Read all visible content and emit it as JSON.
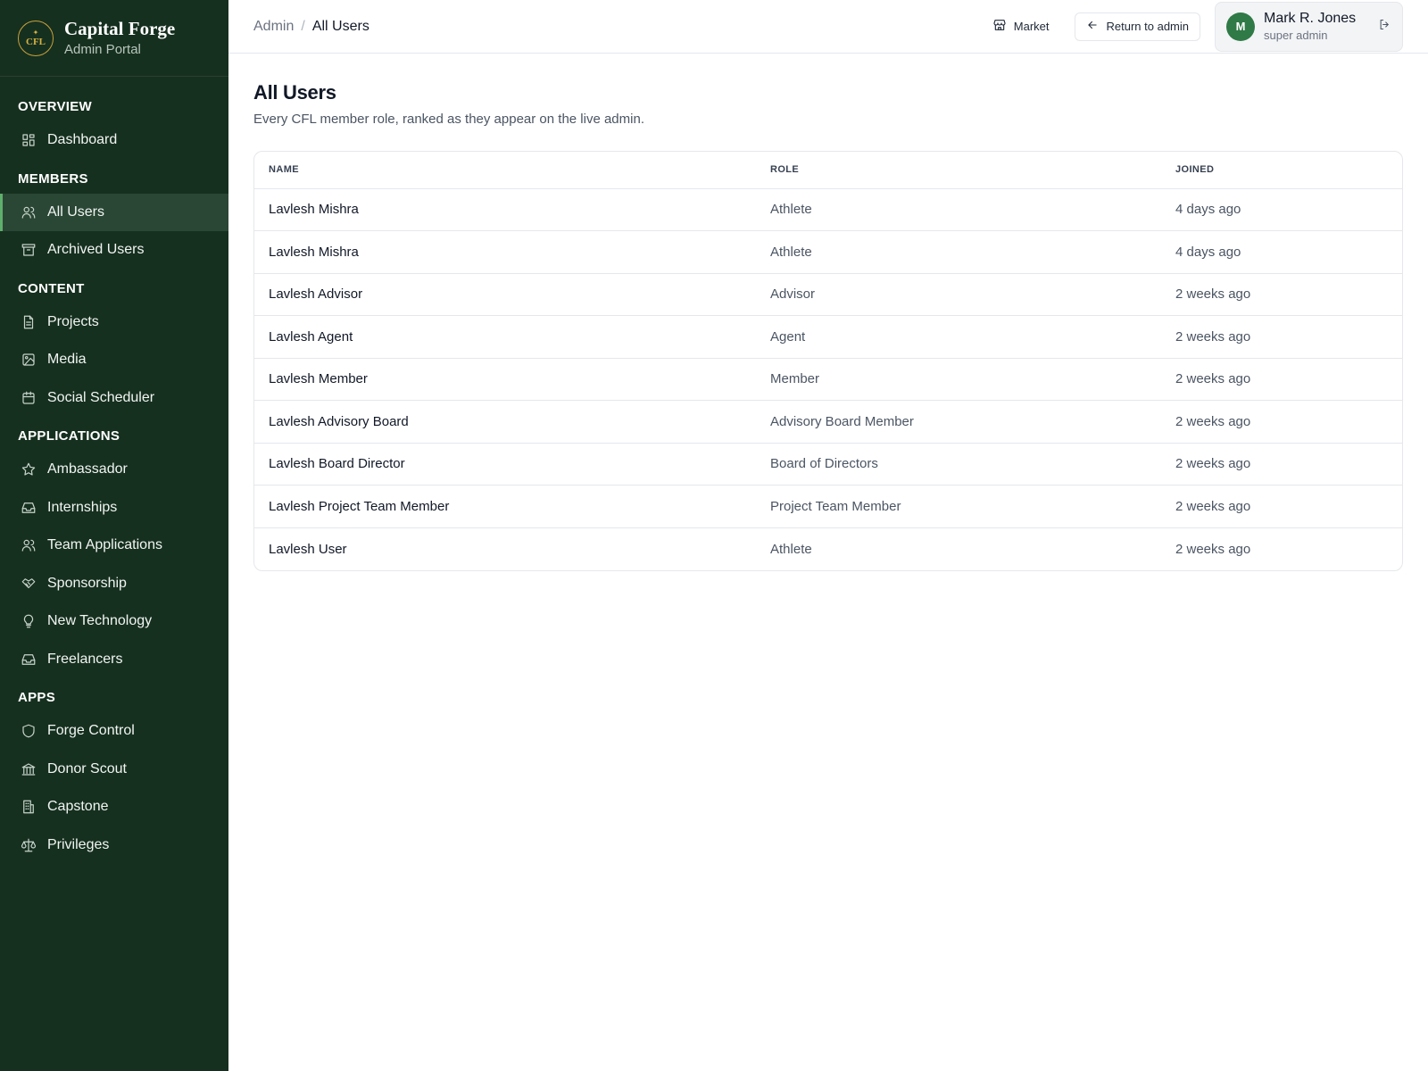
{
  "brand": {
    "name": "Capital Forge",
    "subtitle": "Admin Portal",
    "logo_text": "CFL",
    "colors": {
      "sidebar": "#16301f",
      "accent": "#5fae6c",
      "gold": "#c9a23a"
    }
  },
  "sidebar": {
    "sections": [
      {
        "title": "OVERVIEW",
        "items": [
          {
            "label": "Dashboard",
            "icon": "dashboard-icon"
          }
        ]
      },
      {
        "title": "MEMBERS",
        "items": [
          {
            "label": "All Users",
            "icon": "users-icon",
            "active": true
          },
          {
            "label": "Archived Users",
            "icon": "archive-icon"
          }
        ]
      },
      {
        "title": "CONTENT",
        "items": [
          {
            "label": "Projects",
            "icon": "file-icon"
          },
          {
            "label": "Media",
            "icon": "image-icon"
          },
          {
            "label": "Social Scheduler",
            "icon": "calendar-icon"
          }
        ]
      },
      {
        "title": "APPLICATIONS",
        "items": [
          {
            "label": "Ambassador",
            "icon": "star-icon"
          },
          {
            "label": "Internships",
            "icon": "inbox-icon"
          },
          {
            "label": "Team Applications",
            "icon": "users-icon"
          },
          {
            "label": "Sponsorship",
            "icon": "handshake-icon"
          },
          {
            "label": "New Technology",
            "icon": "lightbulb-icon"
          },
          {
            "label": "Freelancers",
            "icon": "inbox-icon"
          }
        ]
      },
      {
        "title": "APPS",
        "items": [
          {
            "label": "Forge Control",
            "icon": "shield-icon"
          },
          {
            "label": "Donor Scout",
            "icon": "bank-icon"
          },
          {
            "label": "Capstone",
            "icon": "building-icon"
          },
          {
            "label": "Privileges",
            "icon": "scale-icon"
          }
        ]
      }
    ]
  },
  "header": {
    "breadcrumb_root": "Admin",
    "breadcrumb_sep": "/",
    "breadcrumb_current": "All Users",
    "market_label": "Market",
    "return_label": "Return to admin",
    "user": {
      "initial": "M",
      "name": "Mark R. Jones",
      "role": "super admin"
    }
  },
  "main": {
    "title": "All Users",
    "description": "Every CFL member role, ranked as they appear on the live admin.",
    "columns": [
      "NAME",
      "ROLE",
      "JOINED"
    ],
    "rows": [
      {
        "name": "Lavlesh Mishra",
        "role": "Athlete",
        "joined": "4 days ago"
      },
      {
        "name": "Lavlesh Mishra",
        "role": "Athlete",
        "joined": "4 days ago"
      },
      {
        "name": "Lavlesh Advisor",
        "role": "Advisor",
        "joined": "2 weeks ago"
      },
      {
        "name": "Lavlesh Agent",
        "role": "Agent",
        "joined": "2 weeks ago"
      },
      {
        "name": "Lavlesh Member",
        "role": "Member",
        "joined": "2 weeks ago"
      },
      {
        "name": "Lavlesh Advisory Board",
        "role": "Advisory Board Member",
        "joined": "2 weeks ago"
      },
      {
        "name": "Lavlesh Board Director",
        "role": "Board of Directors",
        "joined": "2 weeks ago"
      },
      {
        "name": "Lavlesh Project Team Member",
        "role": "Project Team Member",
        "joined": "2 weeks ago"
      },
      {
        "name": "Lavlesh User",
        "role": "Athlete",
        "joined": "2 weeks ago"
      }
    ]
  }
}
